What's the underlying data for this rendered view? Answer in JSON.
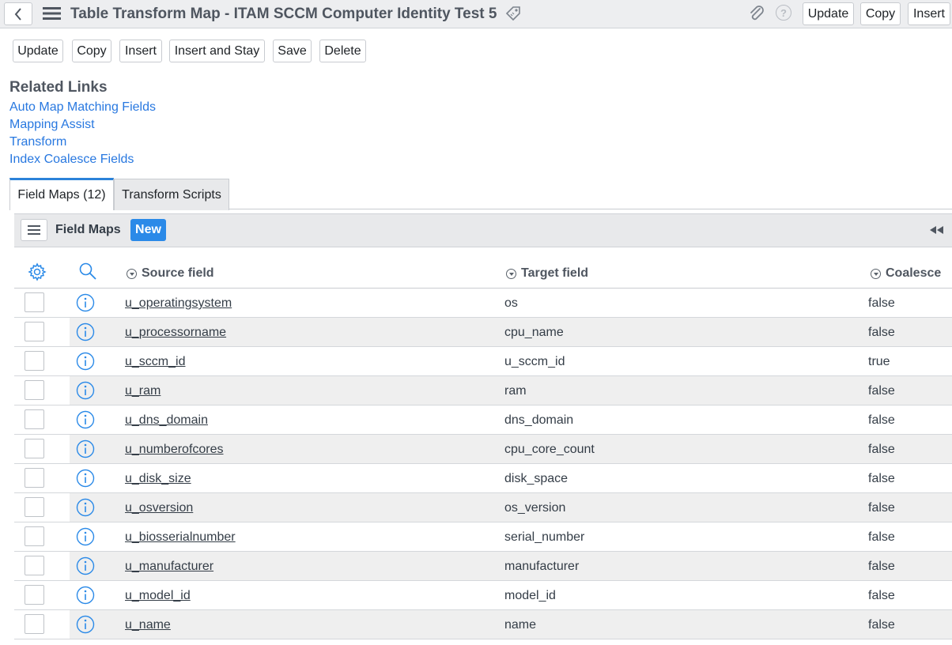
{
  "header": {
    "title": "Table Transform Map - ITAM SCCM Computer Identity Test 5",
    "update_label": "Update",
    "copy_label": "Copy",
    "insert_label": "Insert",
    "icons": [
      "back-icon",
      "hamburger-menu-icon",
      "tag-icon",
      "paperclip-icon",
      "help-icon"
    ]
  },
  "actions": {
    "update_label": "Update",
    "copy_label": "Copy",
    "insert_label": "Insert",
    "insert_stay_label": "Insert and Stay",
    "save_label": "Save",
    "delete_label": "Delete"
  },
  "related": {
    "title": "Related Links",
    "links": [
      "Auto Map Matching Fields",
      "Mapping Assist",
      "Transform",
      "Index Coalesce Fields"
    ]
  },
  "tabs": [
    {
      "label": "Field Maps (12)",
      "active": true
    },
    {
      "label": "Transform Scripts",
      "active": false
    }
  ],
  "list": {
    "title": "Field Maps",
    "new_label": "New",
    "columns": [
      "Source field",
      "Target field",
      "Coalesce"
    ],
    "rows": [
      {
        "source": "u_operatingsystem",
        "target": "os",
        "coalesce": "false"
      },
      {
        "source": "u_processorname",
        "target": "cpu_name",
        "coalesce": "false"
      },
      {
        "source": "u_sccm_id",
        "target": "u_sccm_id",
        "coalesce": "true"
      },
      {
        "source": "u_ram",
        "target": "ram",
        "coalesce": "false"
      },
      {
        "source": "u_dns_domain",
        "target": "dns_domain",
        "coalesce": "false"
      },
      {
        "source": "u_numberofcores",
        "target": "cpu_core_count",
        "coalesce": "false"
      },
      {
        "source": "u_disk_size",
        "target": "disk_space",
        "coalesce": "false"
      },
      {
        "source": "u_osversion",
        "target": "os_version",
        "coalesce": "false"
      },
      {
        "source": "u_biosserialnumber",
        "target": "serial_number",
        "coalesce": "false"
      },
      {
        "source": "u_manufacturer",
        "target": "manufacturer",
        "coalesce": "false"
      },
      {
        "source": "u_model_id",
        "target": "model_id",
        "coalesce": "false"
      },
      {
        "source": "u_name",
        "target": "name",
        "coalesce": "false"
      }
    ]
  },
  "colors": {
    "link": "#2878e0",
    "accent": "#2b8ae8",
    "header_bg": "#edeef0",
    "icon_blue": "#2b8ae8"
  }
}
